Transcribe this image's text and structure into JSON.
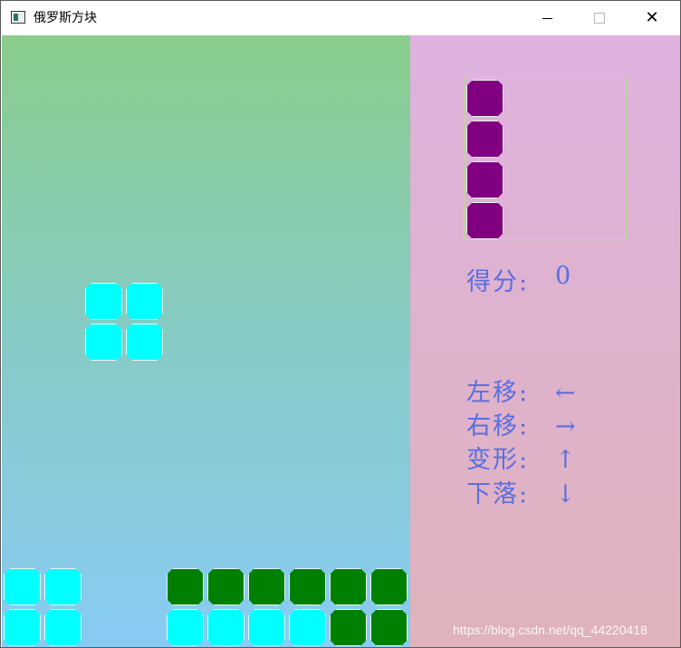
{
  "window": {
    "title": "俄罗斯方块"
  },
  "controls": {
    "minimize": "–",
    "maximize": "□",
    "close": "✕"
  },
  "board": {
    "falling_piece": {
      "type": "O",
      "color": "cyan"
    },
    "locked_rows": [
      [
        "cyan",
        "cyan",
        null,
        null,
        "green",
        "green",
        "green",
        "green",
        "green",
        "green"
      ],
      [
        "cyan",
        "cyan",
        null,
        null,
        "cyan",
        "cyan",
        "cyan",
        "cyan",
        "green",
        "green"
      ]
    ],
    "colors": {
      "cyan": "#00ffff",
      "green": "#008000",
      "purple": "#800080"
    }
  },
  "next_piece": {
    "type": "I",
    "color": "purple"
  },
  "score": {
    "label": "得分:",
    "value": "0"
  },
  "help": [
    {
      "action": "左移:",
      "key": "←"
    },
    {
      "action": "右移:",
      "key": "→"
    },
    {
      "action": "变形:",
      "key": "↑"
    },
    {
      "action": "下落:",
      "key": "↓"
    }
  ],
  "watermark": "https://blog.csdn.net/qq_44220418"
}
